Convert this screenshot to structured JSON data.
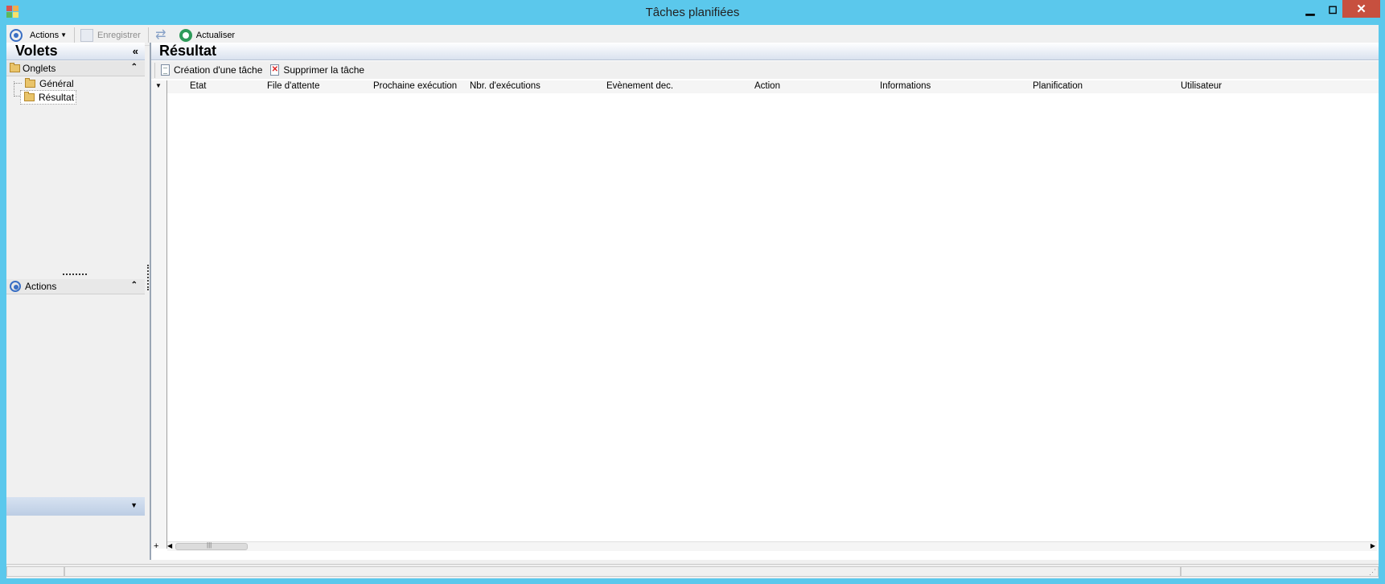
{
  "window": {
    "title": "Tâches planifiées"
  },
  "toolbar": {
    "actions_label": "Actions",
    "save_label": "Enregistrer",
    "refresh_label": "Actualiser"
  },
  "left_pane": {
    "title": "Volets",
    "tabs_group": "Onglets",
    "tree_items": [
      "Général",
      "Résultat"
    ],
    "actions_group": "Actions"
  },
  "right_pane": {
    "title": "Résultat",
    "create_label": "Création d'une tâche",
    "delete_label": "Supprimer la tâche",
    "columns": [
      "Etat",
      "File d'attente",
      "Prochaine exécution",
      "Nbr. d'exécutions",
      "Evènement dec.",
      "Action",
      "Informations",
      "Planification",
      "Utilisateur"
    ]
  },
  "icons": {
    "app": "app-icon",
    "actions": "gear-icon",
    "save": "save-icon",
    "sync": "sync-icon",
    "refresh": "refresh-icon",
    "folder": "folder-icon",
    "create": "document-icon",
    "delete": "delete-document-icon"
  },
  "colors": {
    "window_border": "#5bc8ec",
    "close_button": "#c7503f",
    "pane_background": "#f0f0f0"
  }
}
